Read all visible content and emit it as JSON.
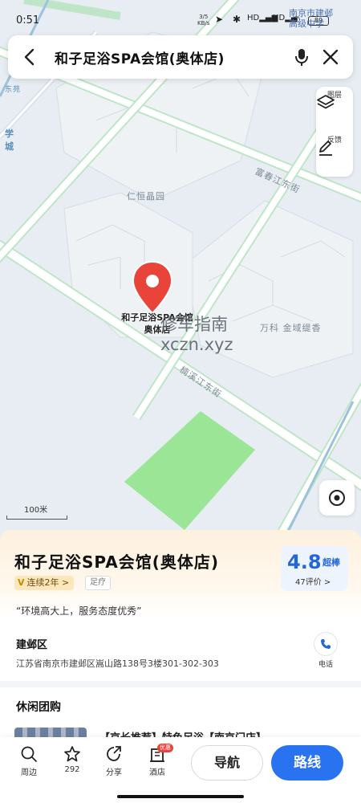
{
  "status": {
    "time": "0:51",
    "net_speed": "3/5",
    "net_unit": "KB/s",
    "battery": "89",
    "overlay_line1": "南京市建邺",
    "overlay_line2": "高级中学"
  },
  "search": {
    "title": "和子足浴SPA会馆(奥体店)"
  },
  "tools": {
    "layers_label": "图层",
    "feedback_label": "反馈"
  },
  "map": {
    "labels": {
      "l1": "仁恒晶园",
      "l2": "富春江东街",
      "l3": "楠溪江东街",
      "l4": "万科 金域缇香",
      "l5": "学",
      "l6": "城",
      "l7": "东苑"
    },
    "pin_label_line1": "和子足浴SPA会馆",
    "pin_label_line2": "奥体店",
    "scale": "100米",
    "watermark_line1": "修车指南",
    "watermark_line2": "xczn.xyz"
  },
  "poi": {
    "name": "和子足浴SPA会馆(奥体店)",
    "badge_v": "V",
    "badge_text": "连续2年 >",
    "category": "足疗",
    "rating": "4.8",
    "rating_tag": "超棒",
    "review_count": "47评价 >",
    "quote": "“环境高大上，服务态度优秀”",
    "district": "建邺区",
    "address": "江苏省南京市建邺区嵩山路138号3楼301-302-303",
    "phone_label": "电话",
    "section_title": "休闲团购",
    "deal_title": "【京长推荐】特色足浴【南京门店】"
  },
  "bottom": {
    "nearby": "周边",
    "favorites": "292",
    "share": "分享",
    "hotel": "酒店",
    "hotel_badge": "优惠",
    "navigate": "导航",
    "route": "路线"
  },
  "colors": {
    "accent": "#2a73f0",
    "pin": "#e8443a",
    "park": "#9be596"
  }
}
